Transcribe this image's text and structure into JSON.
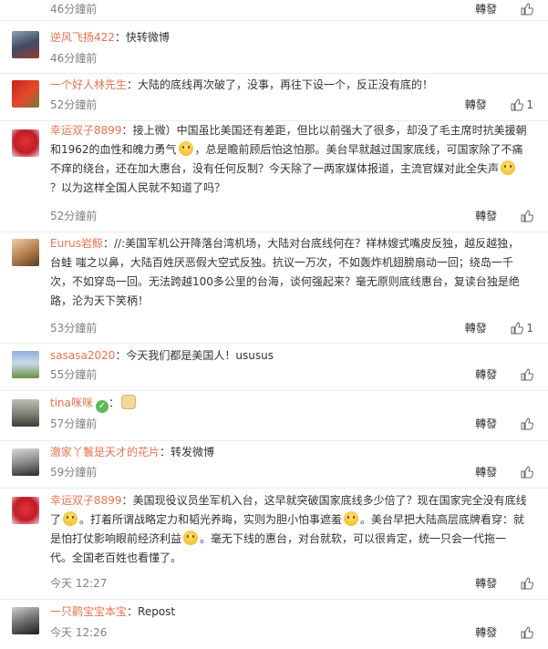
{
  "labels": {
    "reply": "轉發",
    "like_icon": "thumbs-up-icon"
  },
  "colors": {
    "username": "#eb7350",
    "time": "#808080",
    "text": "#333333"
  },
  "top": {
    "time": "46分鐘前",
    "likes": ""
  },
  "comments": [
    {
      "user": "逆风飞扬422",
      "text": "快转微博",
      "time": "46分鐘前",
      "likes": ""
    },
    {
      "user": "一个好人林先生",
      "text": "大陆的底线再次破了，没事，再往下设一个，反正没有底的！",
      "time": "52分鐘前",
      "likes": "1"
    },
    {
      "user": "幸运双子8899",
      "text_parts": [
        "接上微）中国虽比美国还有差距，但比以前强大了很多，却没了毛主席时抗美援朝和1962的血性和魄力勇气",
        "，总是瞻前顾后怕这怕那。美台早就越过国家底线，可国家除了不痛不痒的绕台，还在加大惠台，没有任何反制？今天除了一两家媒体报道，主流官媒对此全失声",
        "？以为这样全国人民就不知道了吗？"
      ],
      "time": "52分鐘前",
      "likes": ""
    },
    {
      "user": "Eurus岩鲸",
      "text": "//:美国军机公开降落台湾机场，大陆对台底线何在？祥林嫂式嘴皮反独，越反越独，台蛙 嗤之以鼻，大陆百姓厌恶假大空式反独。抗议一万次，不如轰炸机翅膀扇动一回；绕岛一千次，不如穿岛一回。无法跨越100多公里的台海，谈何强起来？毫无原则底线惠台，复读台独是绝路，沦为天下笑柄！",
      "time": "53分鐘前",
      "likes": "1"
    },
    {
      "user": "sasasa2020",
      "text": "今天我们都是美国人！ususus",
      "time": "55分鐘前",
      "likes": ""
    },
    {
      "user": "tina咪咪",
      "text": "",
      "time": "57分鐘前",
      "likes": ""
    },
    {
      "user": "澈家丫鬟是天才的花片",
      "text": "转发微博",
      "time": "59分鐘前",
      "likes": ""
    },
    {
      "user": "幸运双子8899",
      "text_parts": [
        "美国现役议员坐军机入台，这早就突破国家底线多少倍了？现在国家完全没有底线了",
        "。打着所谓战略定力和韬光养晦，实则为胆小怕事遮羞",
        "。美台早把大陆高层底牌看穿：就是怕打仗影响眼前经济利益",
        "。毫无下线的惠台，对台就软，可以很肯定，统一只会一代拖一代。全国老百姓也看懂了。"
      ],
      "time": "今天 12:27",
      "likes": ""
    },
    {
      "user": "一只鹳宝宝本宝",
      "text": "Repost",
      "time": "今天 12:26",
      "likes": ""
    }
  ]
}
